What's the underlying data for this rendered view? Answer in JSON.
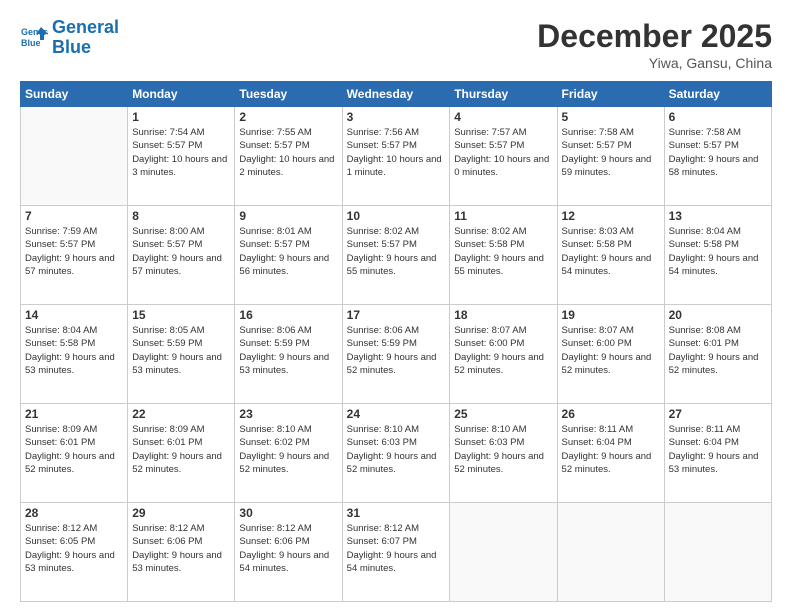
{
  "logo": {
    "line1": "General",
    "line2": "Blue"
  },
  "header": {
    "title": "December 2025",
    "location": "Yiwa, Gansu, China"
  },
  "weekdays": [
    "Sunday",
    "Monday",
    "Tuesday",
    "Wednesday",
    "Thursday",
    "Friday",
    "Saturday"
  ],
  "weeks": [
    [
      {
        "day": "",
        "empty": true
      },
      {
        "day": "1",
        "sunrise": "7:54 AM",
        "sunset": "5:57 PM",
        "daylight": "10 hours and 3 minutes."
      },
      {
        "day": "2",
        "sunrise": "7:55 AM",
        "sunset": "5:57 PM",
        "daylight": "10 hours and 2 minutes."
      },
      {
        "day": "3",
        "sunrise": "7:56 AM",
        "sunset": "5:57 PM",
        "daylight": "10 hours and 1 minute."
      },
      {
        "day": "4",
        "sunrise": "7:57 AM",
        "sunset": "5:57 PM",
        "daylight": "10 hours and 0 minutes."
      },
      {
        "day": "5",
        "sunrise": "7:58 AM",
        "sunset": "5:57 PM",
        "daylight": "9 hours and 59 minutes."
      },
      {
        "day": "6",
        "sunrise": "7:58 AM",
        "sunset": "5:57 PM",
        "daylight": "9 hours and 58 minutes."
      }
    ],
    [
      {
        "day": "7",
        "sunrise": "7:59 AM",
        "sunset": "5:57 PM",
        "daylight": "9 hours and 57 minutes."
      },
      {
        "day": "8",
        "sunrise": "8:00 AM",
        "sunset": "5:57 PM",
        "daylight": "9 hours and 57 minutes."
      },
      {
        "day": "9",
        "sunrise": "8:01 AM",
        "sunset": "5:57 PM",
        "daylight": "9 hours and 56 minutes."
      },
      {
        "day": "10",
        "sunrise": "8:02 AM",
        "sunset": "5:57 PM",
        "daylight": "9 hours and 55 minutes."
      },
      {
        "day": "11",
        "sunrise": "8:02 AM",
        "sunset": "5:58 PM",
        "daylight": "9 hours and 55 minutes."
      },
      {
        "day": "12",
        "sunrise": "8:03 AM",
        "sunset": "5:58 PM",
        "daylight": "9 hours and 54 minutes."
      },
      {
        "day": "13",
        "sunrise": "8:04 AM",
        "sunset": "5:58 PM",
        "daylight": "9 hours and 54 minutes."
      }
    ],
    [
      {
        "day": "14",
        "sunrise": "8:04 AM",
        "sunset": "5:58 PM",
        "daylight": "9 hours and 53 minutes."
      },
      {
        "day": "15",
        "sunrise": "8:05 AM",
        "sunset": "5:59 PM",
        "daylight": "9 hours and 53 minutes."
      },
      {
        "day": "16",
        "sunrise": "8:06 AM",
        "sunset": "5:59 PM",
        "daylight": "9 hours and 53 minutes."
      },
      {
        "day": "17",
        "sunrise": "8:06 AM",
        "sunset": "5:59 PM",
        "daylight": "9 hours and 52 minutes."
      },
      {
        "day": "18",
        "sunrise": "8:07 AM",
        "sunset": "6:00 PM",
        "daylight": "9 hours and 52 minutes."
      },
      {
        "day": "19",
        "sunrise": "8:07 AM",
        "sunset": "6:00 PM",
        "daylight": "9 hours and 52 minutes."
      },
      {
        "day": "20",
        "sunrise": "8:08 AM",
        "sunset": "6:01 PM",
        "daylight": "9 hours and 52 minutes."
      }
    ],
    [
      {
        "day": "21",
        "sunrise": "8:09 AM",
        "sunset": "6:01 PM",
        "daylight": "9 hours and 52 minutes."
      },
      {
        "day": "22",
        "sunrise": "8:09 AM",
        "sunset": "6:01 PM",
        "daylight": "9 hours and 52 minutes."
      },
      {
        "day": "23",
        "sunrise": "8:10 AM",
        "sunset": "6:02 PM",
        "daylight": "9 hours and 52 minutes."
      },
      {
        "day": "24",
        "sunrise": "8:10 AM",
        "sunset": "6:03 PM",
        "daylight": "9 hours and 52 minutes."
      },
      {
        "day": "25",
        "sunrise": "8:10 AM",
        "sunset": "6:03 PM",
        "daylight": "9 hours and 52 minutes."
      },
      {
        "day": "26",
        "sunrise": "8:11 AM",
        "sunset": "6:04 PM",
        "daylight": "9 hours and 52 minutes."
      },
      {
        "day": "27",
        "sunrise": "8:11 AM",
        "sunset": "6:04 PM",
        "daylight": "9 hours and 53 minutes."
      }
    ],
    [
      {
        "day": "28",
        "sunrise": "8:12 AM",
        "sunset": "6:05 PM",
        "daylight": "9 hours and 53 minutes."
      },
      {
        "day": "29",
        "sunrise": "8:12 AM",
        "sunset": "6:06 PM",
        "daylight": "9 hours and 53 minutes."
      },
      {
        "day": "30",
        "sunrise": "8:12 AM",
        "sunset": "6:06 PM",
        "daylight": "9 hours and 54 minutes."
      },
      {
        "day": "31",
        "sunrise": "8:12 AM",
        "sunset": "6:07 PM",
        "daylight": "9 hours and 54 minutes."
      },
      {
        "day": "",
        "empty": true
      },
      {
        "day": "",
        "empty": true
      },
      {
        "day": "",
        "empty": true
      }
    ]
  ]
}
